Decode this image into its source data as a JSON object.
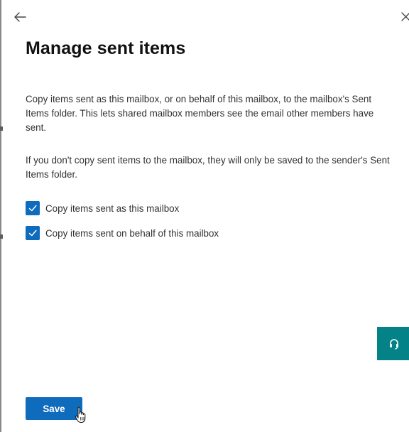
{
  "panel": {
    "title": "Manage sent items",
    "description_1": "Copy items sent as this mailbox, or on behalf of this mailbox, to the mailbox's Sent Items folder. This lets shared mailbox members see the email other members have sent.",
    "description_2": "If you don't copy sent items to the mailbox, they will only be saved to the sender's Sent Items folder."
  },
  "options": [
    {
      "label": "Copy items sent as this mailbox",
      "checked": true
    },
    {
      "label": "Copy items sent on behalf of this mailbox",
      "checked": true
    }
  ],
  "actions": {
    "save_label": "Save"
  },
  "icons": {
    "back": "back-arrow-icon",
    "close": "close-icon",
    "check": "checkmark-icon",
    "help": "headset-icon",
    "cursor": "hand-pointer-icon"
  },
  "colors": {
    "primary": "#0f6cbd",
    "help_fab": "#038387",
    "text": "#323130",
    "title": "#111111"
  }
}
